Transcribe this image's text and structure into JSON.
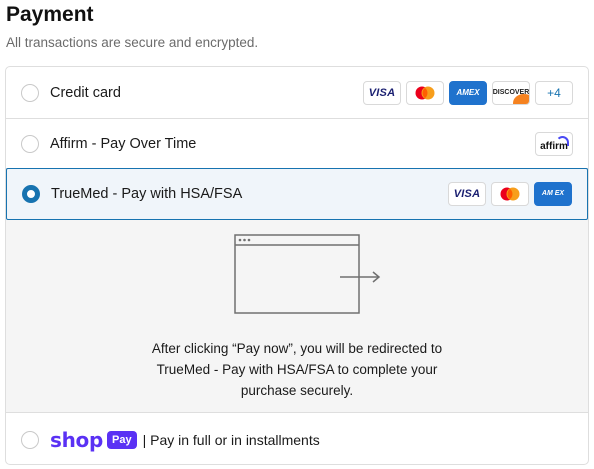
{
  "page": {
    "title": "Payment",
    "subtitle": "All transactions are secure and encrypted."
  },
  "methods": {
    "credit_card": {
      "label": "Credit card",
      "selected": false,
      "card_brands": [
        "visa",
        "mastercard",
        "amex",
        "discover"
      ],
      "visa_text": "VISA",
      "amex_text": "AMEX",
      "discover_text": "DISCOVER",
      "more_text": "+4"
    },
    "affirm": {
      "label": "Affirm - Pay Over Time",
      "selected": false,
      "logo_text": "affirm"
    },
    "truemed": {
      "label": "TrueMed - Pay with HSA/FSA",
      "selected": true,
      "card_brands": [
        "visa",
        "mastercard",
        "amex"
      ],
      "visa_text": "VISA",
      "amex_text": "AM EX",
      "redirect_message": "After clicking “Pay now”, you will be redirected to TrueMed - Pay with HSA/FSA to complete your purchase securely."
    },
    "shop_pay": {
      "logo_word": "shop",
      "pay_badge": "Pay",
      "label": "| Pay in full or in installments",
      "selected": false
    }
  },
  "colors": {
    "accent": "#1773b0",
    "selected_bg": "#f0f5fa",
    "panel_bg": "#f5f5f5",
    "shop_purple": "#5a31f4"
  }
}
